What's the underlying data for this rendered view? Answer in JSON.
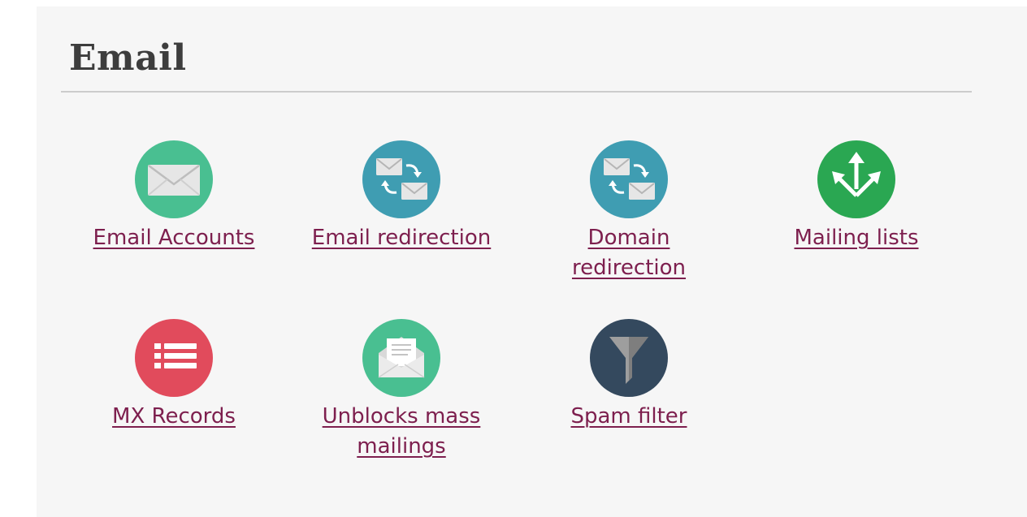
{
  "section": {
    "title": "Email"
  },
  "tiles": [
    {
      "label": "Email Accounts",
      "icon": "envelope-icon",
      "color": "#49bf91"
    },
    {
      "label": "Email redirection",
      "icon": "email-redirect-icon",
      "color": "#3f9db2"
    },
    {
      "label": "Domain redirection",
      "icon": "domain-redirect-icon",
      "color": "#3f9db2"
    },
    {
      "label": "Mailing lists",
      "icon": "mailing-lists-icon",
      "color": "#2aa752"
    },
    {
      "label": "MX Records",
      "icon": "list-icon",
      "color": "#e14b5c"
    },
    {
      "label": "Unblocks mass mailings",
      "icon": "open-envelope-icon",
      "color": "#49bf91"
    },
    {
      "label": "Spam filter",
      "icon": "funnel-icon",
      "color": "#34495e"
    }
  ],
  "colors": {
    "link": "#7d1f4e",
    "title": "#3d3d3d",
    "panel_bg": "#f6f6f6",
    "divider": "#cccccc"
  }
}
